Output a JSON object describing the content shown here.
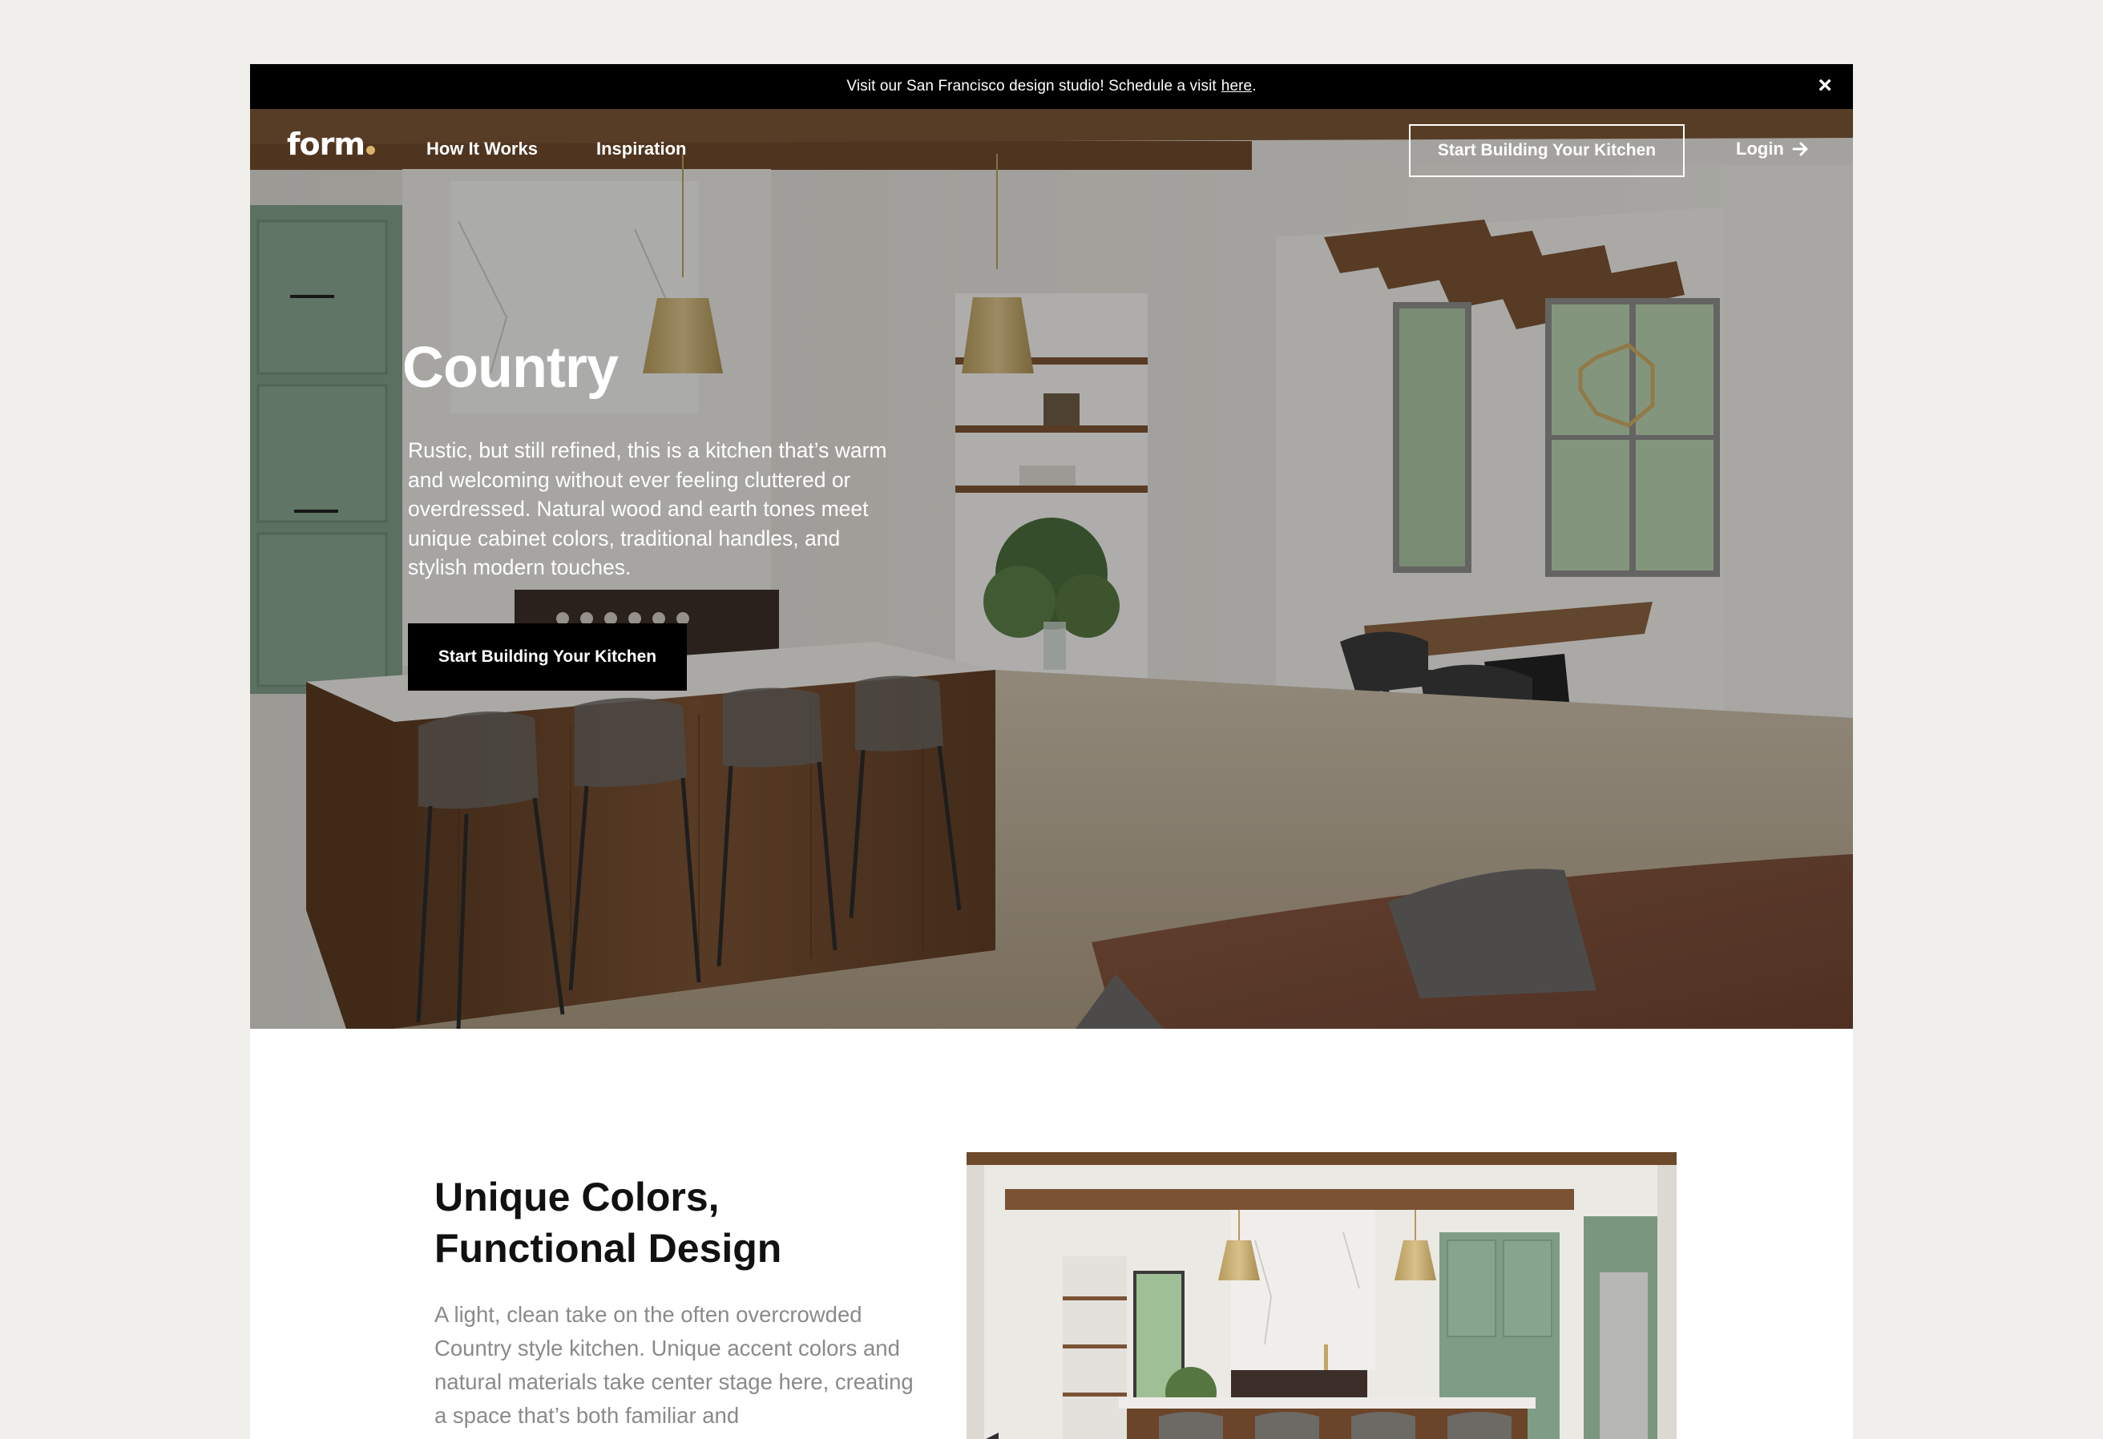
{
  "announcement": {
    "text": "Visit our San Francisco design studio! Schedule a visit",
    "link": "here",
    "end": ".",
    "close_icon": "×"
  },
  "nav": {
    "logo": "form",
    "links": [
      "How It Works",
      "Inspiration"
    ],
    "cta": "Start Building Your Kitchen",
    "login": "Login"
  },
  "hero": {
    "title": "Country",
    "description": "Rustic, but still refined, this is a kitchen that’s warm and welcoming without ever feeling cluttered or overdressed. Natural wood and earth tones meet unique cabinet colors, traditional handles, and stylish modern touches.",
    "cta": "Start Building Your Kitchen"
  },
  "section": {
    "title_line1": "Unique Colors,",
    "title_line2": "Functional Design",
    "description": "A light, clean take on the often overcrowded Country style kitchen. Unique accent colors and natural materials take center stage here, creating a space that’s both familiar and"
  },
  "colors": {
    "accent": "#d9b56a",
    "cabinet_green": "#7f9c86",
    "wood": "#6b4529",
    "black": "#000000"
  }
}
